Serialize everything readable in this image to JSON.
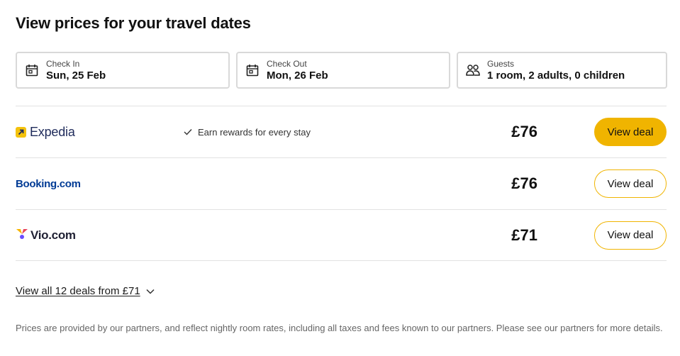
{
  "title": "View prices for your travel dates",
  "fields": {
    "check_in": {
      "label": "Check In",
      "value": "Sun, 25 Feb",
      "icon": "calendar-icon"
    },
    "check_out": {
      "label": "Check Out",
      "value": "Mon, 26 Feb",
      "icon": "calendar-icon"
    },
    "guests": {
      "label": "Guests",
      "value": "1 room, 2 adults, 0 children",
      "icon": "people-icon"
    }
  },
  "deals": [
    {
      "provider": "Expedia",
      "perk": "Earn rewards for every stay",
      "price": "£76",
      "button": "View deal"
    },
    {
      "provider": "Booking.com",
      "price": "£76",
      "button": "View deal"
    },
    {
      "provider": "Vio.com",
      "price": "£71",
      "button": "View deal"
    }
  ],
  "view_all": "View all 12 deals from £71",
  "disclaimer": "Prices are provided by our partners, and reflect nightly room rates, including all taxes and fees known to our partners. Please see our partners for more details.",
  "colors": {
    "accent": "#f0b400",
    "expedia_mark": "#f4c20d",
    "expedia_text": "#1f2b5b",
    "booking_text": "#003b95",
    "vio_text": "#1f2033"
  }
}
